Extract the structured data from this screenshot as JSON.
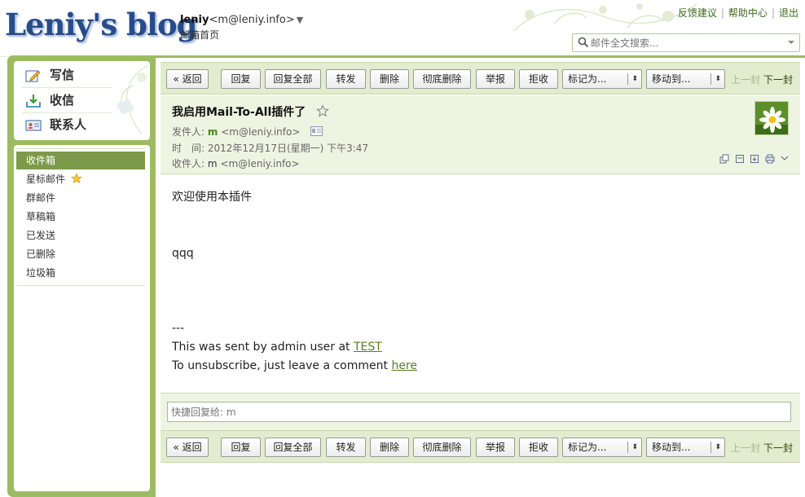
{
  "header": {
    "logo": "Leniy's blog",
    "user_name": "leniy",
    "user_email": "<m@leniy.info>",
    "caret": "▼",
    "mail_home": "邮箱首页",
    "links": [
      "反馈建议",
      "帮助中心",
      "退出"
    ],
    "search_placeholder": "邮件全文搜索..."
  },
  "sidebar": {
    "quick": [
      {
        "label": "写信",
        "icon": "compose-icon"
      },
      {
        "label": "收信",
        "icon": "inbox-download-icon"
      },
      {
        "label": "联系人",
        "icon": "contacts-card-icon"
      }
    ],
    "folders": [
      "收件箱",
      "星标邮件",
      "群邮件",
      "草稿箱",
      "已发送",
      "已删除",
      "垃圾箱"
    ],
    "active_folder": "收件箱"
  },
  "toolbar": {
    "back": "« 返回",
    "reply": "回复",
    "reply_all": "回复全部",
    "forward": "转发",
    "delete": "删除",
    "delete_permanent": "彻底删除",
    "report": "举报",
    "reject": "拒收",
    "mark_as": "标记为...",
    "move_to": "移动到...",
    "prev": "上一封",
    "next": "下一封"
  },
  "mail": {
    "subject": "我启用Mail-To-All插件了",
    "from_label": "发件人:",
    "from_name": "m",
    "from_email": "<m@leniy.info>",
    "time_label": "时　间:",
    "time_value": "2012年12月17日(星期一) 下午3:47",
    "to_label": "收件人:",
    "to_name": "m",
    "to_email": "<m@leniy.info>",
    "body": {
      "line1": "欢迎使用本插件",
      "line2": "qqq",
      "line3": "---",
      "line4_prefix": "This was sent by admin user at ",
      "line4_link": "TEST",
      "line5_prefix": "To unsubscribe, just leave a comment ",
      "line5_link": "here"
    }
  },
  "reply": {
    "placeholder": "快捷回复给: m"
  },
  "colors": {
    "frame_green": "#9cbb63",
    "active_folder": "#7c9a49",
    "toolbar_bg": "#e2ecce",
    "link_green": "#3b6a18"
  }
}
